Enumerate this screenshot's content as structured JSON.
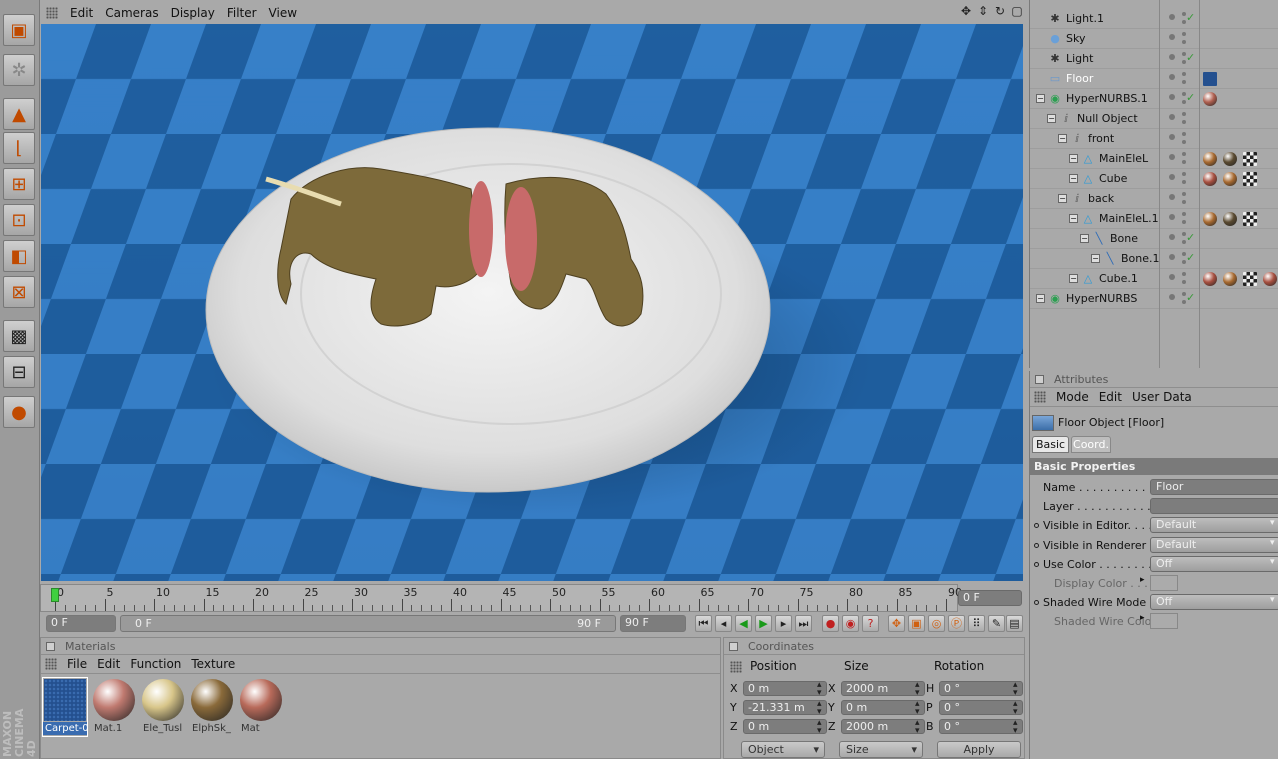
{
  "viewport_menu": [
    "Edit",
    "Cameras",
    "Display",
    "Filter",
    "View"
  ],
  "brand": "MAXON CINEMA 4D",
  "timeline": {
    "ticks": [
      "0",
      "5",
      "10",
      "15",
      "20",
      "25",
      "30",
      "35",
      "40",
      "45",
      "50",
      "55",
      "60",
      "65",
      "70",
      "75",
      "80",
      "85",
      "90"
    ],
    "current_frame": "0 F",
    "start_field": "0 F",
    "range_start": "0 F",
    "range_end": "90 F",
    "end_field": "90 F"
  },
  "materials": {
    "title": "Materials",
    "menu": [
      "File",
      "Edit",
      "Function",
      "Texture"
    ],
    "items": [
      {
        "label": "Carpet-0",
        "color": "#24508f"
      },
      {
        "label": "Mat.1",
        "color": "#c07a70"
      },
      {
        "label": "Ele_Tusl",
        "color": "#d8c68a"
      },
      {
        "label": "ElphSk_",
        "color": "#8a6a3a"
      },
      {
        "label": "Mat",
        "color": "#b86a5a"
      }
    ]
  },
  "coordinates": {
    "title": "Coordinates",
    "headers": {
      "position": "Position",
      "size": "Size",
      "rotation": "Rotation"
    },
    "rows": [
      {
        "axis": "X",
        "pos": "0 m",
        "size_axis": "X",
        "size": "2000 m",
        "rot_axis": "H",
        "rot": "0 °"
      },
      {
        "axis": "Y",
        "pos": "-21.331 m",
        "size_axis": "Y",
        "size": "0 m",
        "rot_axis": "P",
        "rot": "0 °"
      },
      {
        "axis": "Z",
        "pos": "0 m",
        "size_axis": "Z",
        "size": "2000 m",
        "rot_axis": "B",
        "rot": "0 °"
      }
    ],
    "mode_select": "Object",
    "size_select": "Size",
    "apply_label": "Apply"
  },
  "objects": [
    {
      "name": "Light.1",
      "indent": 0,
      "icon": "light-icon",
      "check": true,
      "tags": []
    },
    {
      "name": "Sky",
      "indent": 0,
      "icon": "sky-icon",
      "check": false,
      "tags": []
    },
    {
      "name": "Light",
      "indent": 0,
      "icon": "light-icon",
      "check": true,
      "tags": []
    },
    {
      "name": "Floor",
      "indent": 0,
      "icon": "floor-icon",
      "check": false,
      "tags": [
        "#24508f"
      ]
    },
    {
      "name": "HyperNURBS.1",
      "indent": 0,
      "icon": "hypernurbs-icon",
      "check": true,
      "tags": [
        "#b06050"
      ]
    },
    {
      "name": "Null Object",
      "indent": 1,
      "icon": "null-icon",
      "check": false,
      "tags": []
    },
    {
      "name": "front",
      "indent": 2,
      "icon": "null-icon",
      "check": false,
      "tags": []
    },
    {
      "name": "MainEleL",
      "indent": 3,
      "icon": "polygon-icon",
      "check": false,
      "tags": [
        "#a86a30",
        "#5a4a30",
        "#cccccc"
      ]
    },
    {
      "name": "Cube",
      "indent": 3,
      "icon": "polygon-icon",
      "check": false,
      "tags": [
        "#a85040",
        "#a86a30",
        "#cccccc"
      ]
    },
    {
      "name": "back",
      "indent": 2,
      "icon": "null-icon",
      "check": false,
      "tags": []
    },
    {
      "name": "MainEleL.1",
      "indent": 3,
      "icon": "polygon-icon",
      "check": false,
      "tags": [
        "#a86a30",
        "#5a4a30",
        "#cccccc"
      ]
    },
    {
      "name": "Bone",
      "indent": 4,
      "icon": "bone-icon",
      "check": true,
      "tags": []
    },
    {
      "name": "Bone.1",
      "indent": 5,
      "icon": "bone-icon",
      "check": true,
      "tags": []
    },
    {
      "name": "Cube.1",
      "indent": 3,
      "icon": "polygon-icon",
      "check": false,
      "tags": [
        "#a85040",
        "#a86a30",
        "#cccccc",
        "#a85040"
      ]
    },
    {
      "name": "HyperNURBS",
      "indent": 0,
      "icon": "hypernurbs-icon",
      "check": true,
      "tags": []
    }
  ],
  "attributes": {
    "title": "Attributes",
    "menu": [
      "Mode",
      "Edit",
      "User Data"
    ],
    "object_title": "Floor Object [Floor]",
    "tabs": [
      "Basic",
      "Coord."
    ],
    "section": "Basic Properties",
    "props": [
      {
        "label": "Name . . . . . . . . . . . . .",
        "value": "Floor",
        "bullet": false,
        "kind": "field"
      },
      {
        "label": "Layer . . . . . . . . . . . . .",
        "value": "",
        "bullet": false,
        "kind": "field"
      },
      {
        "label": "Visible in Editor. . . . .",
        "value": "Default",
        "bullet": true,
        "kind": "drop"
      },
      {
        "label": "Visible in Renderer . .",
        "value": "Default",
        "bullet": true,
        "kind": "drop"
      },
      {
        "label": "Use Color . . . . . . . . .",
        "value": "Off",
        "bullet": true,
        "kind": "drop"
      },
      {
        "label": "Display Color . . . .",
        "value": "",
        "bullet": false,
        "kind": "swatch"
      },
      {
        "label": "Shaded Wire Mode",
        "value": "Off",
        "bullet": true,
        "kind": "drop"
      },
      {
        "label": "Shaded Wire Color",
        "value": "",
        "bullet": false,
        "kind": "swatch"
      }
    ]
  }
}
